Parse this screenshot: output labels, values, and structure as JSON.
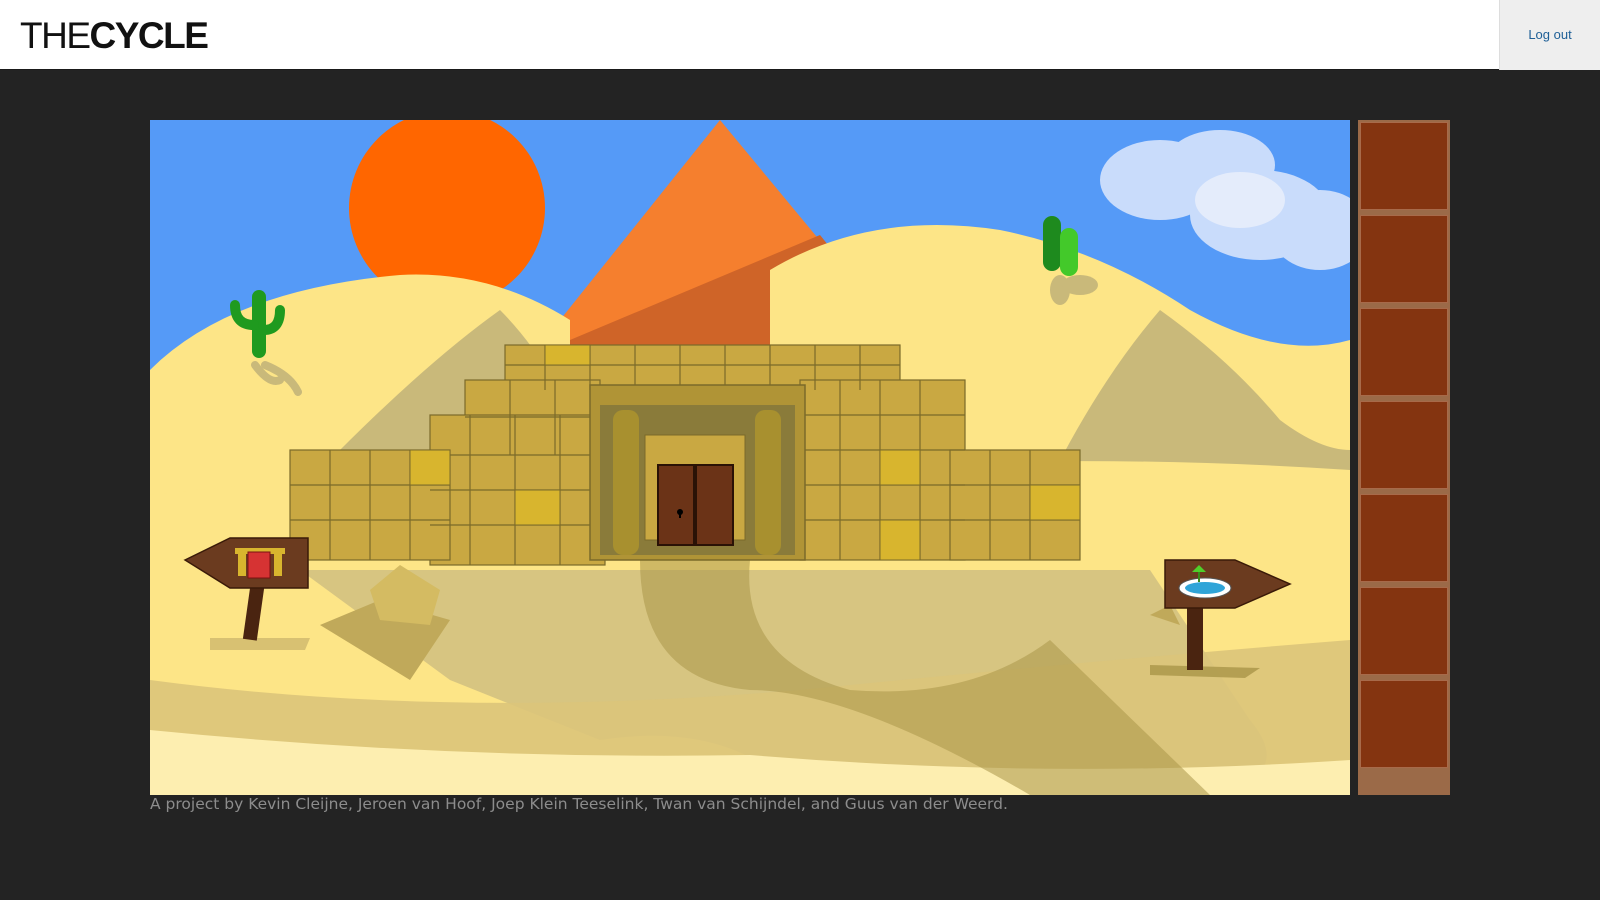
{
  "header": {
    "logo_thin": "THE",
    "logo_bold": "CYCLE",
    "logout_label": "Log out"
  },
  "scene": {
    "name": "desert-pyramid",
    "colors": {
      "sky": "#559af7",
      "sun": "#ff6600",
      "sand_light": "#fde587",
      "sand_shadow": "#c9b97a",
      "pyramid": "#f57f2e",
      "pyramid_shadow": "#cf6428",
      "stone": "#c9a842",
      "door": "#6b3317"
    },
    "left_sign_icon": "temple-icon",
    "right_sign_icon": "oasis-icon"
  },
  "inventory": {
    "slot_count": 7,
    "slot_color": "#843410"
  },
  "footer": {
    "credits": "A project by Kevin Cleijne, Jeroen van Hoof, Joep Klein Teeselink, Twan van Schijndel, and Guus van der Weerd."
  }
}
